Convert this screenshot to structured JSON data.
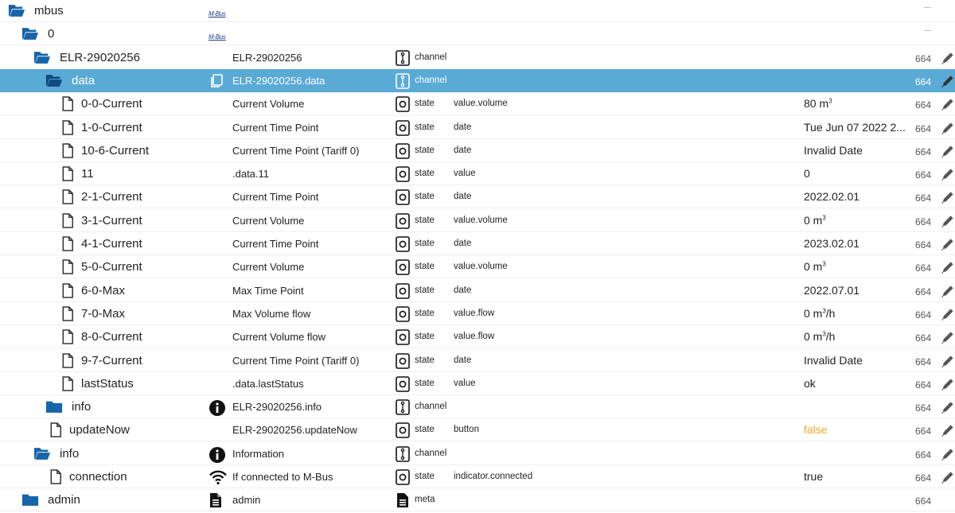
{
  "rows": [
    {
      "indent": 10,
      "icon": "folder-open",
      "name": "mbus",
      "nameIcon": "mbus-logo",
      "mbusText": "M-Bus",
      "obj": "",
      "type": "",
      "typeLabel": "",
      "role": "",
      "value": "",
      "rights": "---",
      "edit": false
    },
    {
      "indent": 27,
      "icon": "folder-open",
      "name": "0",
      "nameIcon": "mbus-logo",
      "mbusText": "M-Bus",
      "obj": "",
      "type": "",
      "typeLabel": "",
      "role": "",
      "value": "",
      "rights": "---",
      "edit": false
    },
    {
      "indent": 42,
      "icon": "folder-open",
      "name": "ELR-29020256",
      "nameIcon": "",
      "obj": "ELR-29020256",
      "type": "channel",
      "typeLabel": "channel",
      "role": "",
      "value": "",
      "rights": "664",
      "edit": true
    },
    {
      "indent": 57,
      "icon": "folder-open",
      "name": "data",
      "nameIcon": "copy",
      "obj": "ELR-29020256.data",
      "type": "channel",
      "typeLabel": "channel",
      "role": "",
      "value": "",
      "rights": "664",
      "edit": true,
      "selected": true
    },
    {
      "indent": 77,
      "icon": "file",
      "name": "0-0-Current",
      "nameIcon": "",
      "obj": "Current Volume",
      "type": "state",
      "typeLabel": "state",
      "role": "value.volume",
      "value": "80 m",
      "valueSup": "3",
      "rights": "664",
      "edit": true
    },
    {
      "indent": 77,
      "icon": "file",
      "name": "1-0-Current",
      "nameIcon": "",
      "obj": "Current Time Point",
      "type": "state",
      "typeLabel": "state",
      "role": "date",
      "value": "Tue Jun 07 2022 2...",
      "rights": "664",
      "edit": true
    },
    {
      "indent": 77,
      "icon": "file",
      "name": "10-6-Current",
      "nameIcon": "",
      "obj": "Current Time Point (Tariff 0)",
      "type": "state",
      "typeLabel": "state",
      "role": "date",
      "value": "Invalid Date",
      "rights": "664",
      "edit": true
    },
    {
      "indent": 77,
      "icon": "file",
      "name": "11",
      "nameIcon": "",
      "obj": ".data.11",
      "type": "state",
      "typeLabel": "state",
      "role": "value",
      "value": "0",
      "rights": "664",
      "edit": true
    },
    {
      "indent": 77,
      "icon": "file",
      "name": "2-1-Current",
      "nameIcon": "",
      "obj": "Current Time Point",
      "type": "state",
      "typeLabel": "state",
      "role": "date",
      "value": "2022.02.01",
      "rights": "664",
      "edit": true
    },
    {
      "indent": 77,
      "icon": "file",
      "name": "3-1-Current",
      "nameIcon": "",
      "obj": "Current Volume",
      "type": "state",
      "typeLabel": "state",
      "role": "value.volume",
      "value": "0 m",
      "valueSup": "3",
      "rights": "664",
      "edit": true
    },
    {
      "indent": 77,
      "icon": "file",
      "name": "4-1-Current",
      "nameIcon": "",
      "obj": "Current Time Point",
      "type": "state",
      "typeLabel": "state",
      "role": "date",
      "value": "2023.02.01",
      "rights": "664",
      "edit": true
    },
    {
      "indent": 77,
      "icon": "file",
      "name": "5-0-Current",
      "nameIcon": "",
      "obj": "Current Volume",
      "type": "state",
      "typeLabel": "state",
      "role": "value.volume",
      "value": "0 m",
      "valueSup": "3",
      "rights": "664",
      "edit": true
    },
    {
      "indent": 77,
      "icon": "file",
      "name": "6-0-Max",
      "nameIcon": "",
      "obj": "Max Time Point",
      "type": "state",
      "typeLabel": "state",
      "role": "date",
      "value": "2022.07.01",
      "rights": "664",
      "edit": true
    },
    {
      "indent": 77,
      "icon": "file",
      "name": "7-0-Max",
      "nameIcon": "",
      "obj": "Max Volume flow",
      "type": "state",
      "typeLabel": "state",
      "role": "value.flow",
      "value": "0 m",
      "valueSup": "3",
      "valueSuffix": "/h",
      "rights": "664",
      "edit": true
    },
    {
      "indent": 77,
      "icon": "file",
      "name": "8-0-Current",
      "nameIcon": "",
      "obj": "Current Volume flow",
      "type": "state",
      "typeLabel": "state",
      "role": "value.flow",
      "value": "0 m",
      "valueSup": "3",
      "valueSuffix": "/h",
      "rights": "664",
      "edit": true
    },
    {
      "indent": 77,
      "icon": "file",
      "name": "9-7-Current",
      "nameIcon": "",
      "obj": "Current Time Point (Tariff 0)",
      "type": "state",
      "typeLabel": "state",
      "role": "date",
      "value": "Invalid Date",
      "rights": "664",
      "edit": true
    },
    {
      "indent": 77,
      "icon": "file",
      "name": "lastStatus",
      "nameIcon": "",
      "obj": ".data.lastStatus",
      "type": "state",
      "typeLabel": "state",
      "role": "value",
      "value": "ok",
      "rights": "664",
      "edit": true
    },
    {
      "indent": 57,
      "icon": "folder-closed",
      "name": "info",
      "nameIcon": "info",
      "obj": "ELR-29020256.info",
      "type": "channel",
      "typeLabel": "channel",
      "role": "",
      "value": "",
      "rights": "664",
      "edit": true
    },
    {
      "indent": 62,
      "icon": "file",
      "name": "updateNow",
      "nameIcon": "",
      "obj": "ELR-29020256.updateNow",
      "type": "state",
      "typeLabel": "state",
      "role": "button",
      "value": "false",
      "valueColor": "orange",
      "rights": "664",
      "edit": true
    },
    {
      "indent": 42,
      "icon": "folder-open",
      "name": "info",
      "nameIcon": "info",
      "obj": "Information",
      "type": "channel",
      "typeLabel": "channel",
      "role": "",
      "value": "",
      "rights": "664",
      "edit": true
    },
    {
      "indent": 62,
      "icon": "file",
      "name": "connection",
      "nameIcon": "wifi",
      "obj": "If connected to M-Bus",
      "type": "state",
      "typeLabel": "state",
      "role": "indicator.connected",
      "value": "true",
      "rights": "664",
      "edit": true
    },
    {
      "indent": 27,
      "icon": "folder-closed",
      "name": "admin",
      "nameIcon": "doc",
      "obj": "admin",
      "type": "meta",
      "typeLabel": "meta",
      "role": "",
      "value": "",
      "rights": "664",
      "edit": false
    }
  ]
}
